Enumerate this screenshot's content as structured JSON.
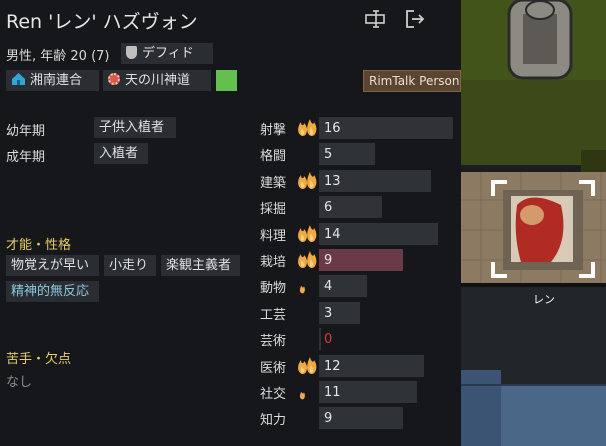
{
  "pawn": {
    "name": "Ren 'レン' ハズヴォン",
    "info": "男性, 年齢 20 (7)",
    "xenotype": "デフィド",
    "faction": "湘南連合",
    "ideology": "天の川神道",
    "rimtalk": "RimTalk Persona",
    "portrait_label": "レン"
  },
  "backstory": [
    {
      "label": "幼年期",
      "value": "子供入植者"
    },
    {
      "label": "成年期",
      "value": "入植者"
    }
  ],
  "traits_title": "才能・性格",
  "traits": [
    "物覚えが早い",
    "小走り",
    "楽観主義者",
    "精神的無反応"
  ],
  "incap_title": "苦手・欠点",
  "incap_none": "なし",
  "skills": [
    {
      "name": "射撃",
      "level": 16,
      "passion": "major"
    },
    {
      "name": "格闘",
      "level": 5,
      "passion": "none"
    },
    {
      "name": "建築",
      "level": 13,
      "passion": "major"
    },
    {
      "name": "採掘",
      "level": 6,
      "passion": "none"
    },
    {
      "name": "料理",
      "level": 14,
      "passion": "major"
    },
    {
      "name": "栽培",
      "level": 9,
      "passion": "major",
      "highlight": true
    },
    {
      "name": "動物",
      "level": 4,
      "passion": "minor"
    },
    {
      "name": "工芸",
      "level": 3,
      "passion": "none"
    },
    {
      "name": "芸術",
      "level": 0,
      "passion": "none",
      "disabled_color": true
    },
    {
      "name": "医術",
      "level": 12,
      "passion": "major"
    },
    {
      "name": "社交",
      "level": 11,
      "passion": "minor"
    },
    {
      "name": "知力",
      "level": 9,
      "passion": "none"
    }
  ],
  "colors": {
    "section": "#e7cf5a",
    "faction_green": "#63c04f",
    "bar": "#2f3236",
    "bar_highlight": "#6b3a48",
    "zero_value": "#d23c3c"
  }
}
